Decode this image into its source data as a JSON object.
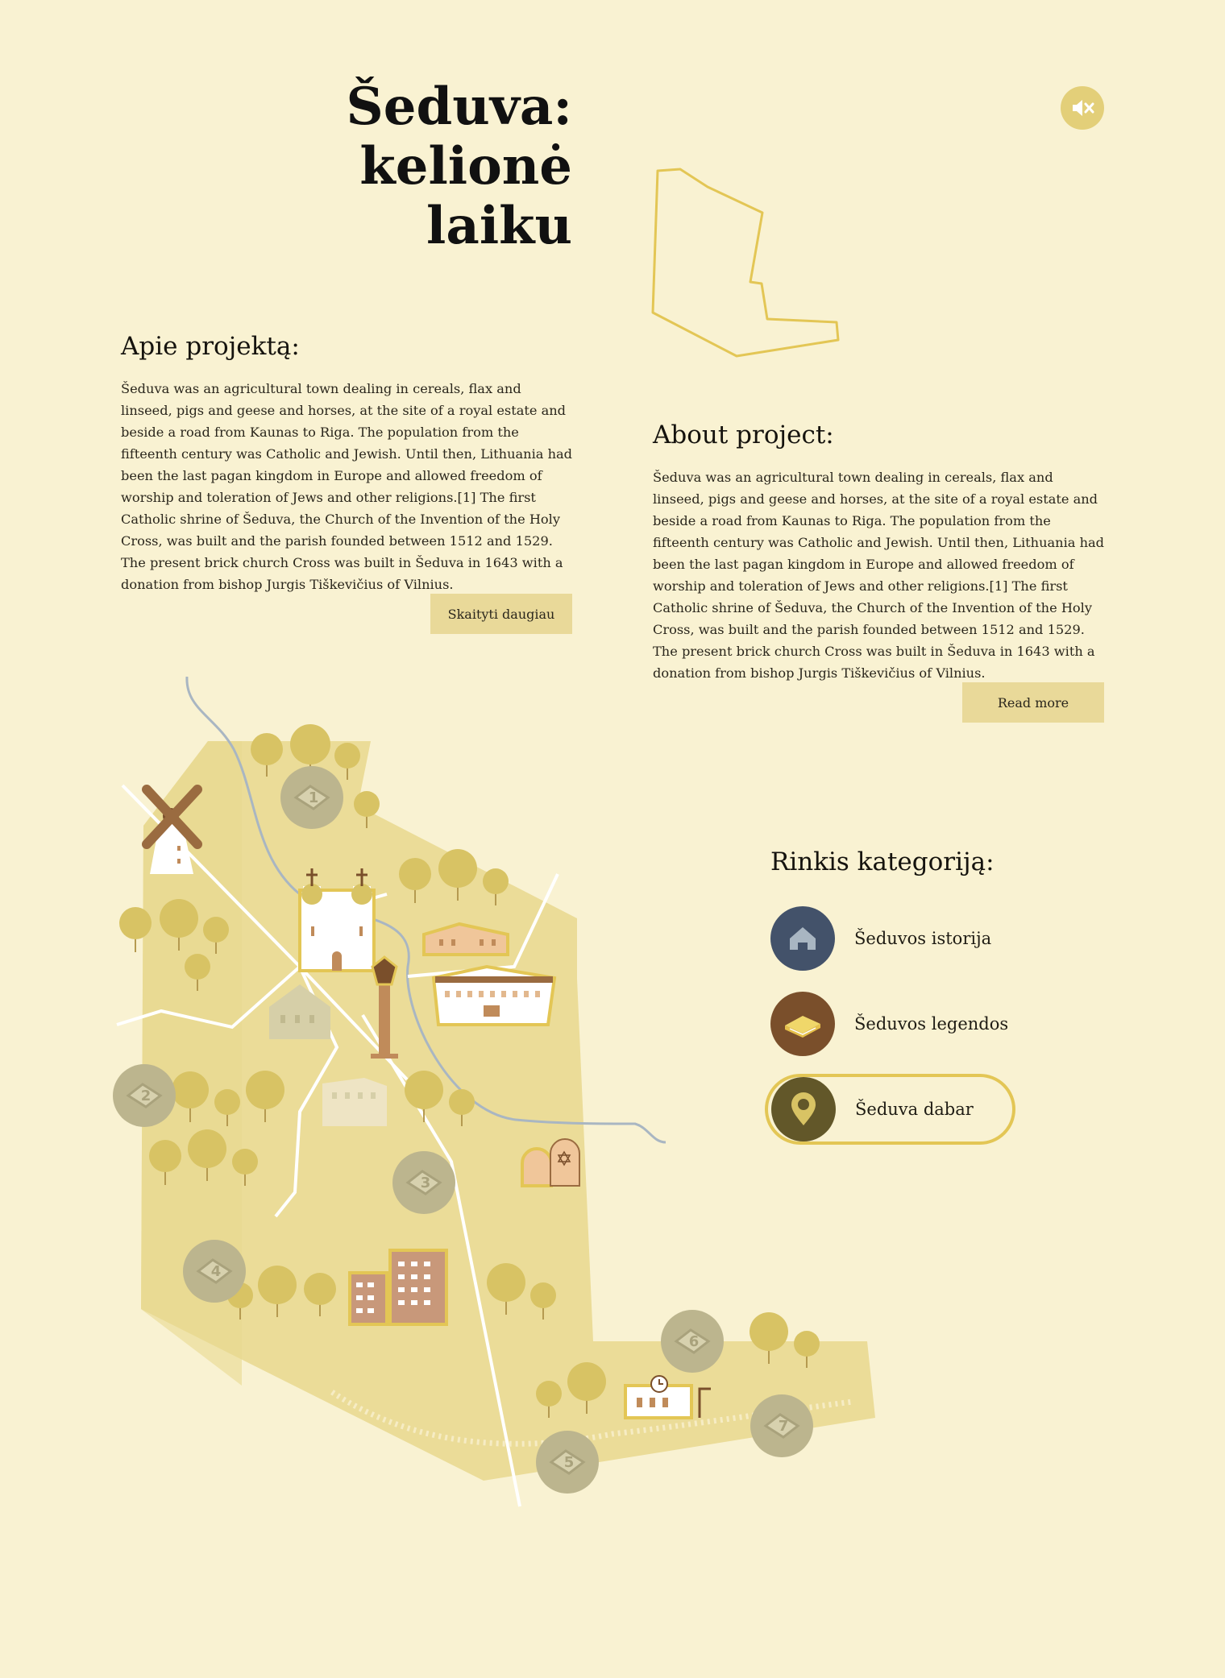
{
  "header": {
    "title_line1": "Šeduva:",
    "title_line2": "kelionė",
    "title_line3": "laiku"
  },
  "sound": {
    "icon": "speaker-muted-icon",
    "color": "#e3cf79"
  },
  "about_lt": {
    "heading": "Apie projektą:",
    "body": "Šeduva was an agricultural town dealing in cereals, flax and linseed, pigs and geese and horses, at the site of a royal estate and beside a road from Kaunas to Riga. The population from the fifteenth century was Catholic and Jewish. Until then, Lithuania had been the last pagan kingdom in Europe and allowed freedom of worship and toleration of Jews and other religions.[1] The first Catholic shrine of Šeduva, the Church of the Invention of the Holy Cross, was built and the parish founded between 1512 and 1529. The present brick church Cross was built in Šeduva in 1643 with a donation from bishop Jurgis Tiškevičius of Vilnius.",
    "button": "Skaityti daugiau"
  },
  "about_en": {
    "heading": "About project:",
    "body": "Šeduva was an agricultural town dealing in cereals, flax and linseed, pigs and geese and horses, at the site of a royal estate and beside a road from Kaunas to Riga. The population from the fifteenth century was Catholic and Jewish. Until then, Lithuania had been the last pagan kingdom in Europe and allowed freedom of worship and toleration of Jews and other religions.[1] The first Catholic shrine of Šeduva, the Church of the Invention of the Holy Cross, was built and the parish founded between 1512 and 1529. The present brick church Cross was built in Šeduva in 1643 with a donation from bishop Jurgis Tiškevičius of Vilnius.",
    "button": "Read more"
  },
  "categories": {
    "heading": "Rinkis kategoriją:",
    "items": [
      {
        "label": "Šeduvos istorija",
        "icon": "house-icon",
        "color": "#43526a"
      },
      {
        "label": "Šeduvos legendos",
        "icon": "book-icon",
        "color": "#7a4f2b"
      },
      {
        "label": "Šeduva dabar",
        "icon": "location-pin-icon",
        "color": "#625729",
        "active": true
      }
    ]
  },
  "map": {
    "markers": [
      "1",
      "2",
      "3",
      "4",
      "5",
      "6",
      "7"
    ],
    "colors": {
      "land": "#ebdc98",
      "tree": "#d8c364",
      "marker": "#bcb58e",
      "river": "#a9b6c2"
    }
  }
}
